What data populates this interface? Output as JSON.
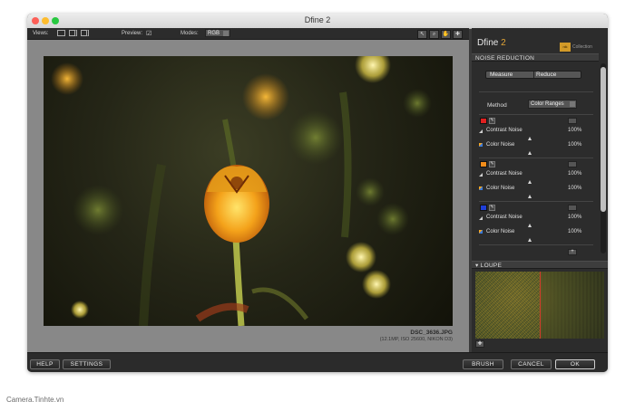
{
  "window": {
    "title": "Dfine 2"
  },
  "toolbar": {
    "views_label": "Views:",
    "preview_label": "Preview:",
    "modes_label": "Modes:",
    "mode_value": "RGB"
  },
  "photo": {
    "filename": "DSC_3636.JPG",
    "info": "(12.1MP, ISO 25600, NIKON D3)"
  },
  "panel": {
    "title_word": "Dfine",
    "title_num": "2",
    "brand_text": "Collection",
    "noise_reduction_heading": "NOISE REDUCTION",
    "measure_label": "Measure",
    "reduce_label": "Reduce",
    "method_label": "Method",
    "method_value": "Color Ranges",
    "groups": [
      {
        "color": "#e02020",
        "contrast_label": "Contrast Noise",
        "contrast_value": "100%",
        "color_label": "Color Noise",
        "color_value": "100%"
      },
      {
        "color": "#f08c1a",
        "contrast_label": "Contrast Noise",
        "contrast_value": "100%",
        "color_label": "Color Noise",
        "color_value": "100%"
      },
      {
        "color": "#1f3fd8",
        "contrast_label": "Contrast Noise",
        "contrast_value": "100%",
        "color_label": "Color Noise",
        "color_value": "100%"
      }
    ],
    "loupe_heading": "LOUPE"
  },
  "bottom": {
    "help": "HELP",
    "settings": "SETTINGS",
    "brush": "BRUSH",
    "cancel": "CANCEL",
    "ok": "OK"
  },
  "watermark": "Camera.Tinhte.vn"
}
